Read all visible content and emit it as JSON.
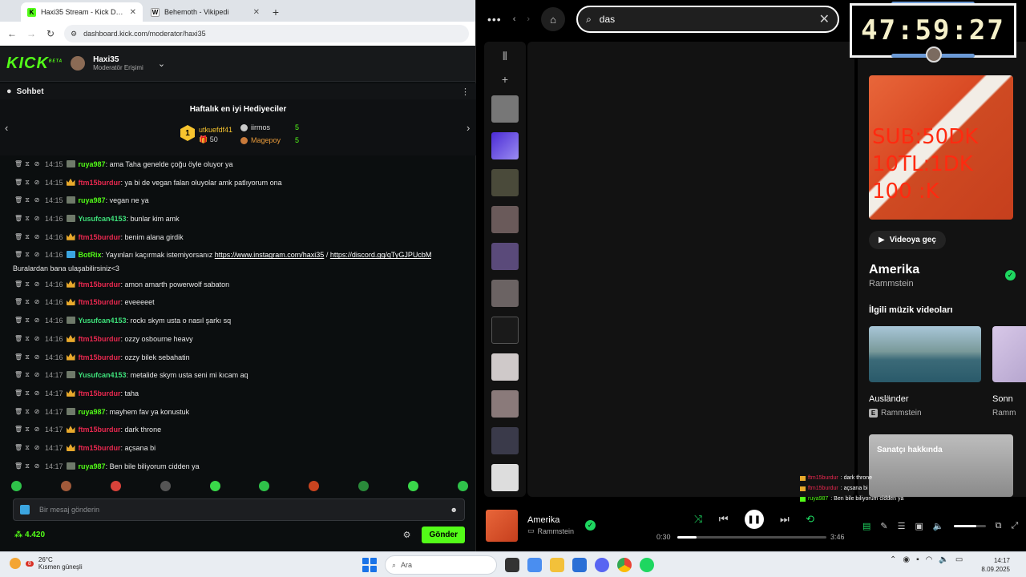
{
  "browser": {
    "tabs": [
      {
        "title": "Haxi35 Stream - Kick Dashboard",
        "active": true
      },
      {
        "title": "Behemoth - Vikipedi",
        "active": false
      }
    ],
    "new_tab": "+",
    "url": "dashboard.kick.com/moderator/haxi35"
  },
  "kick": {
    "logo": "KICK",
    "logo_beta": "BETA",
    "channel_name": "Haxi35",
    "channel_role": "Moderatör Erişimi",
    "chat_title": "Sohbet",
    "gifters_title": "Haftalık en iyi Hediyeciler",
    "gifters": [
      {
        "rank": "1",
        "name": "utkuefdf41",
        "count": "50"
      },
      {
        "name": "iirmos",
        "count": "5"
      },
      {
        "name": "Magepoy",
        "count": "5"
      }
    ],
    "messages": [
      {
        "time": "14:15",
        "badge": "sub",
        "user": "ruya987",
        "color": "#53fc18",
        "text": ": ama Taha genelde çoğu öyle oluyor ya"
      },
      {
        "time": "14:15",
        "badge": "crown",
        "user": "ftm15burdur",
        "color": "#e8284f",
        "text": ": ya bi de vegan falan oluyolar amk patlıyorum ona"
      },
      {
        "time": "14:15",
        "badge": "sub",
        "user": "ruya987",
        "color": "#53fc18",
        "text": ": vegan ne ya"
      },
      {
        "time": "14:16",
        "badge": "sub",
        "user": "Yusufcan4153",
        "color": "#3ee07a",
        "text": ": bunlar kim amk"
      },
      {
        "time": "14:16",
        "badge": "crown",
        "user": "ftm15burdur",
        "color": "#e8284f",
        "text": ": benim alana girdik"
      },
      {
        "time": "14:16",
        "badge": "bot",
        "user": "BotRix",
        "color": "#53fc18",
        "text": ": Yayınları kaçırmak istemiyorsanız ",
        "link1": "https://www.instagram.com/haxi35",
        "sep": " / ",
        "link2": "https://discord.gg/qTyGJPUcbM",
        "text2": "Buralardan bana ulaşabilirsiniz<3"
      },
      {
        "time": "14:16",
        "badge": "crown",
        "user": "ftm15burdur",
        "color": "#e8284f",
        "text": ": amon amarth powerwolf sabaton"
      },
      {
        "time": "14:16",
        "badge": "crown",
        "user": "ftm15burdur",
        "color": "#e8284f",
        "text": ": eveeeeet"
      },
      {
        "time": "14:16",
        "badge": "sub",
        "user": "Yusufcan4153",
        "color": "#3ee07a",
        "text": ": rockı skym usta o nasıl şarkı sq"
      },
      {
        "time": "14:16",
        "badge": "crown",
        "user": "ftm15burdur",
        "color": "#e8284f",
        "text": ": ozzy osbourne heavy"
      },
      {
        "time": "14:16",
        "badge": "crown",
        "user": "ftm15burdur",
        "color": "#e8284f",
        "text": ": ozzy bilek sebahatin"
      },
      {
        "time": "14:17",
        "badge": "sub",
        "user": "Yusufcan4153",
        "color": "#3ee07a",
        "text": ": metalide skym usta seni mi kıcam aq"
      },
      {
        "time": "14:17",
        "badge": "crown",
        "user": "ftm15burdur",
        "color": "#e8284f",
        "text": ": taha"
      },
      {
        "time": "14:17",
        "badge": "sub",
        "user": "ruya987",
        "color": "#53fc18",
        "text": ": mayhem fav ya konustuk"
      },
      {
        "time": "14:17",
        "badge": "crown",
        "user": "ftm15burdur",
        "color": "#e8284f",
        "text": ": dark throne"
      },
      {
        "time": "14:17",
        "badge": "crown",
        "user": "ftm15burdur",
        "color": "#e8284f",
        "text": ": açsana bi"
      },
      {
        "time": "14:17",
        "badge": "sub",
        "user": "ruya987",
        "color": "#53fc18",
        "text": ": Ben bile biliyorum cidden ya"
      }
    ],
    "input_placeholder": "Bir mesaj gönderin",
    "points": "4.420",
    "send_label": "Gönder"
  },
  "spotify": {
    "search_value": "das",
    "now_playing": {
      "title": "Amerika",
      "artist": "Rammstein",
      "overlay_text": "SUB:50DK\n10TL:1DK\n100 :K",
      "video_button": "Videoya geç"
    },
    "related_title": "İlgili müzik videoları",
    "related": [
      {
        "name": "Ausländer",
        "artist": "Rammstein",
        "explicit": "E"
      },
      {
        "name": "Sonn",
        "artist": "Ramm",
        "explicit": ""
      }
    ],
    "artist_card_label": "Sanatçı hakkında",
    "player": {
      "elapsed": "0:30",
      "duration": "3:46",
      "progress": 0.13,
      "volume": 0.7
    }
  },
  "timer": {
    "value": "47:59:27"
  },
  "overlay_chat": [
    {
      "user": "ftm15burdur",
      "text": ": dark throne",
      "color": "#e8284f"
    },
    {
      "user": "ftm15burdur",
      "text": ": açsana bi",
      "color": "#e8284f"
    },
    {
      "user": "ruya987",
      "text": ": Ben bile biliyorum cidden ya",
      "color": "#53fc18"
    }
  ],
  "taskbar": {
    "weather_temp": "26°C",
    "weather_desc": "Kısmen güneşli",
    "weather_badge": "8",
    "search_placeholder": "Ara",
    "time": "14:17",
    "date": "8.09.2025"
  },
  "colors": {
    "kick_green": "#53fc18",
    "spotify_green": "#1ed760"
  }
}
